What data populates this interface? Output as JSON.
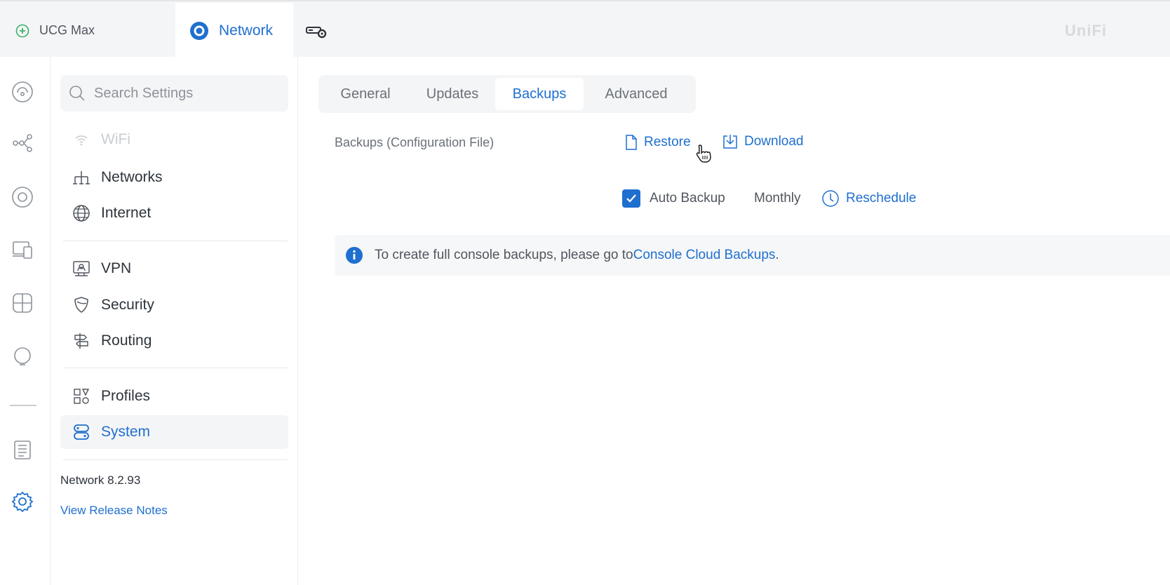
{
  "topbar": {
    "device_name": "UCG Max",
    "app_name": "Network",
    "brand": "UniFi",
    "accent_color": "#1f6fcf"
  },
  "rail": {
    "icons": [
      "dashboard-icon",
      "topology-icon",
      "unifi-devices-icon",
      "client-devices-icon",
      "insights-icon",
      "alerts-icon",
      "system-log-icon",
      "settings-icon"
    ]
  },
  "sidebar": {
    "search_placeholder": "Search Settings",
    "items": [
      {
        "label": "WiFi",
        "icon": "wifi-icon"
      },
      {
        "label": "Networks",
        "icon": "networks-icon"
      },
      {
        "label": "Internet",
        "icon": "globe-icon"
      },
      {
        "label": "VPN",
        "icon": "vpn-icon"
      },
      {
        "label": "Security",
        "icon": "shield-icon"
      },
      {
        "label": "Routing",
        "icon": "routing-icon"
      },
      {
        "label": "Profiles",
        "icon": "profiles-icon"
      },
      {
        "label": "System",
        "icon": "system-icon"
      }
    ],
    "version": "Network 8.2.93",
    "release_notes": "View Release Notes"
  },
  "main": {
    "tabs": [
      "General",
      "Updates",
      "Backups",
      "Advanced"
    ],
    "active_tab": "Backups",
    "backups_label": "Backups (Configuration File)",
    "restore": "Restore",
    "download": "Download",
    "auto_backup_label": "Auto Backup",
    "auto_backup_checked": true,
    "frequency": "Monthly",
    "reschedule": "Reschedule",
    "info_text": "To create full console backups, please go to ",
    "info_link": "Console Cloud Backups",
    "info_end": "."
  }
}
